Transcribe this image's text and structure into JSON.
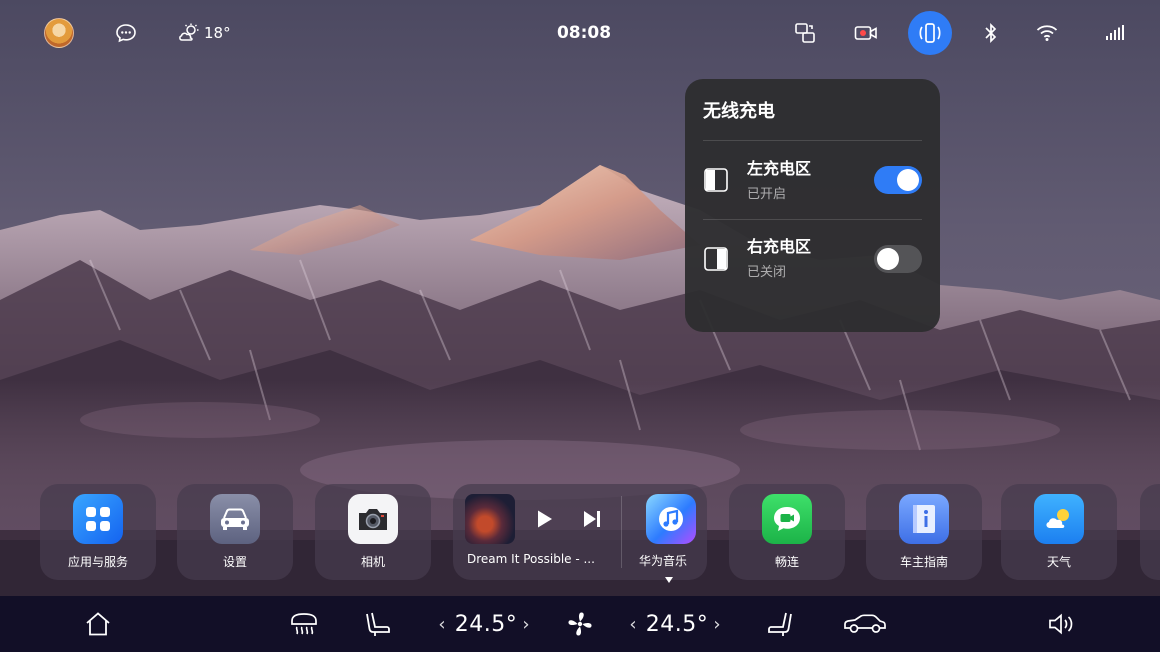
{
  "status_bar": {
    "weather_temp": "18°",
    "time": "08:08"
  },
  "wireless_charging_panel": {
    "title": "无线充电",
    "zones": [
      {
        "name": "左充电区",
        "state": "已开启",
        "enabled": true
      },
      {
        "name": "右充电区",
        "state": "已关闭",
        "enabled": false
      }
    ]
  },
  "dock": {
    "apps": [
      {
        "label": "应用与服务",
        "icon": "apps-services-icon"
      },
      {
        "label": "设置",
        "icon": "car-settings-icon"
      },
      {
        "label": "相机",
        "icon": "camera-icon"
      },
      {
        "label": "畅连",
        "icon": "meetime-icon"
      },
      {
        "label": "车主指南",
        "icon": "owner-guide-icon"
      },
      {
        "label": "天气",
        "icon": "weather-app-icon"
      }
    ],
    "music": {
      "song_title": "Dream It Possible - ...",
      "app_label": "华为音乐"
    }
  },
  "control_bar": {
    "left_temp": "24.5°",
    "right_temp": "24.5°"
  },
  "colors": {
    "accent": "#2f7cf6",
    "panel_bg": "#2e2e30",
    "control_bar_bg": "#120f27"
  }
}
